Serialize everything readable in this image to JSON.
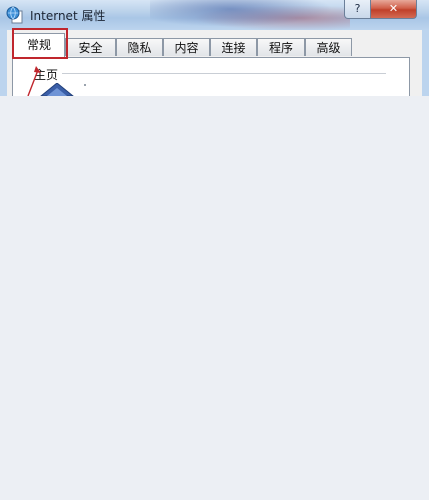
{
  "window": {
    "title": "Internet 属性",
    "help_label": "?",
    "close_label": "✕"
  },
  "tabs": [
    {
      "label": "常规",
      "active": true
    },
    {
      "label": "安全",
      "active": false
    },
    {
      "label": "隐私",
      "active": false
    },
    {
      "label": "内容",
      "active": false
    },
    {
      "label": "连接",
      "active": false
    },
    {
      "label": "程序",
      "active": false
    },
    {
      "label": "高级",
      "active": false
    }
  ],
  "general": {
    "homepage_group_label": "主页"
  },
  "icons": {
    "app": "globe-page-icon",
    "homepage": "house-icon"
  },
  "colors": {
    "highlight": "#c0262d",
    "background": "#eceff4"
  }
}
